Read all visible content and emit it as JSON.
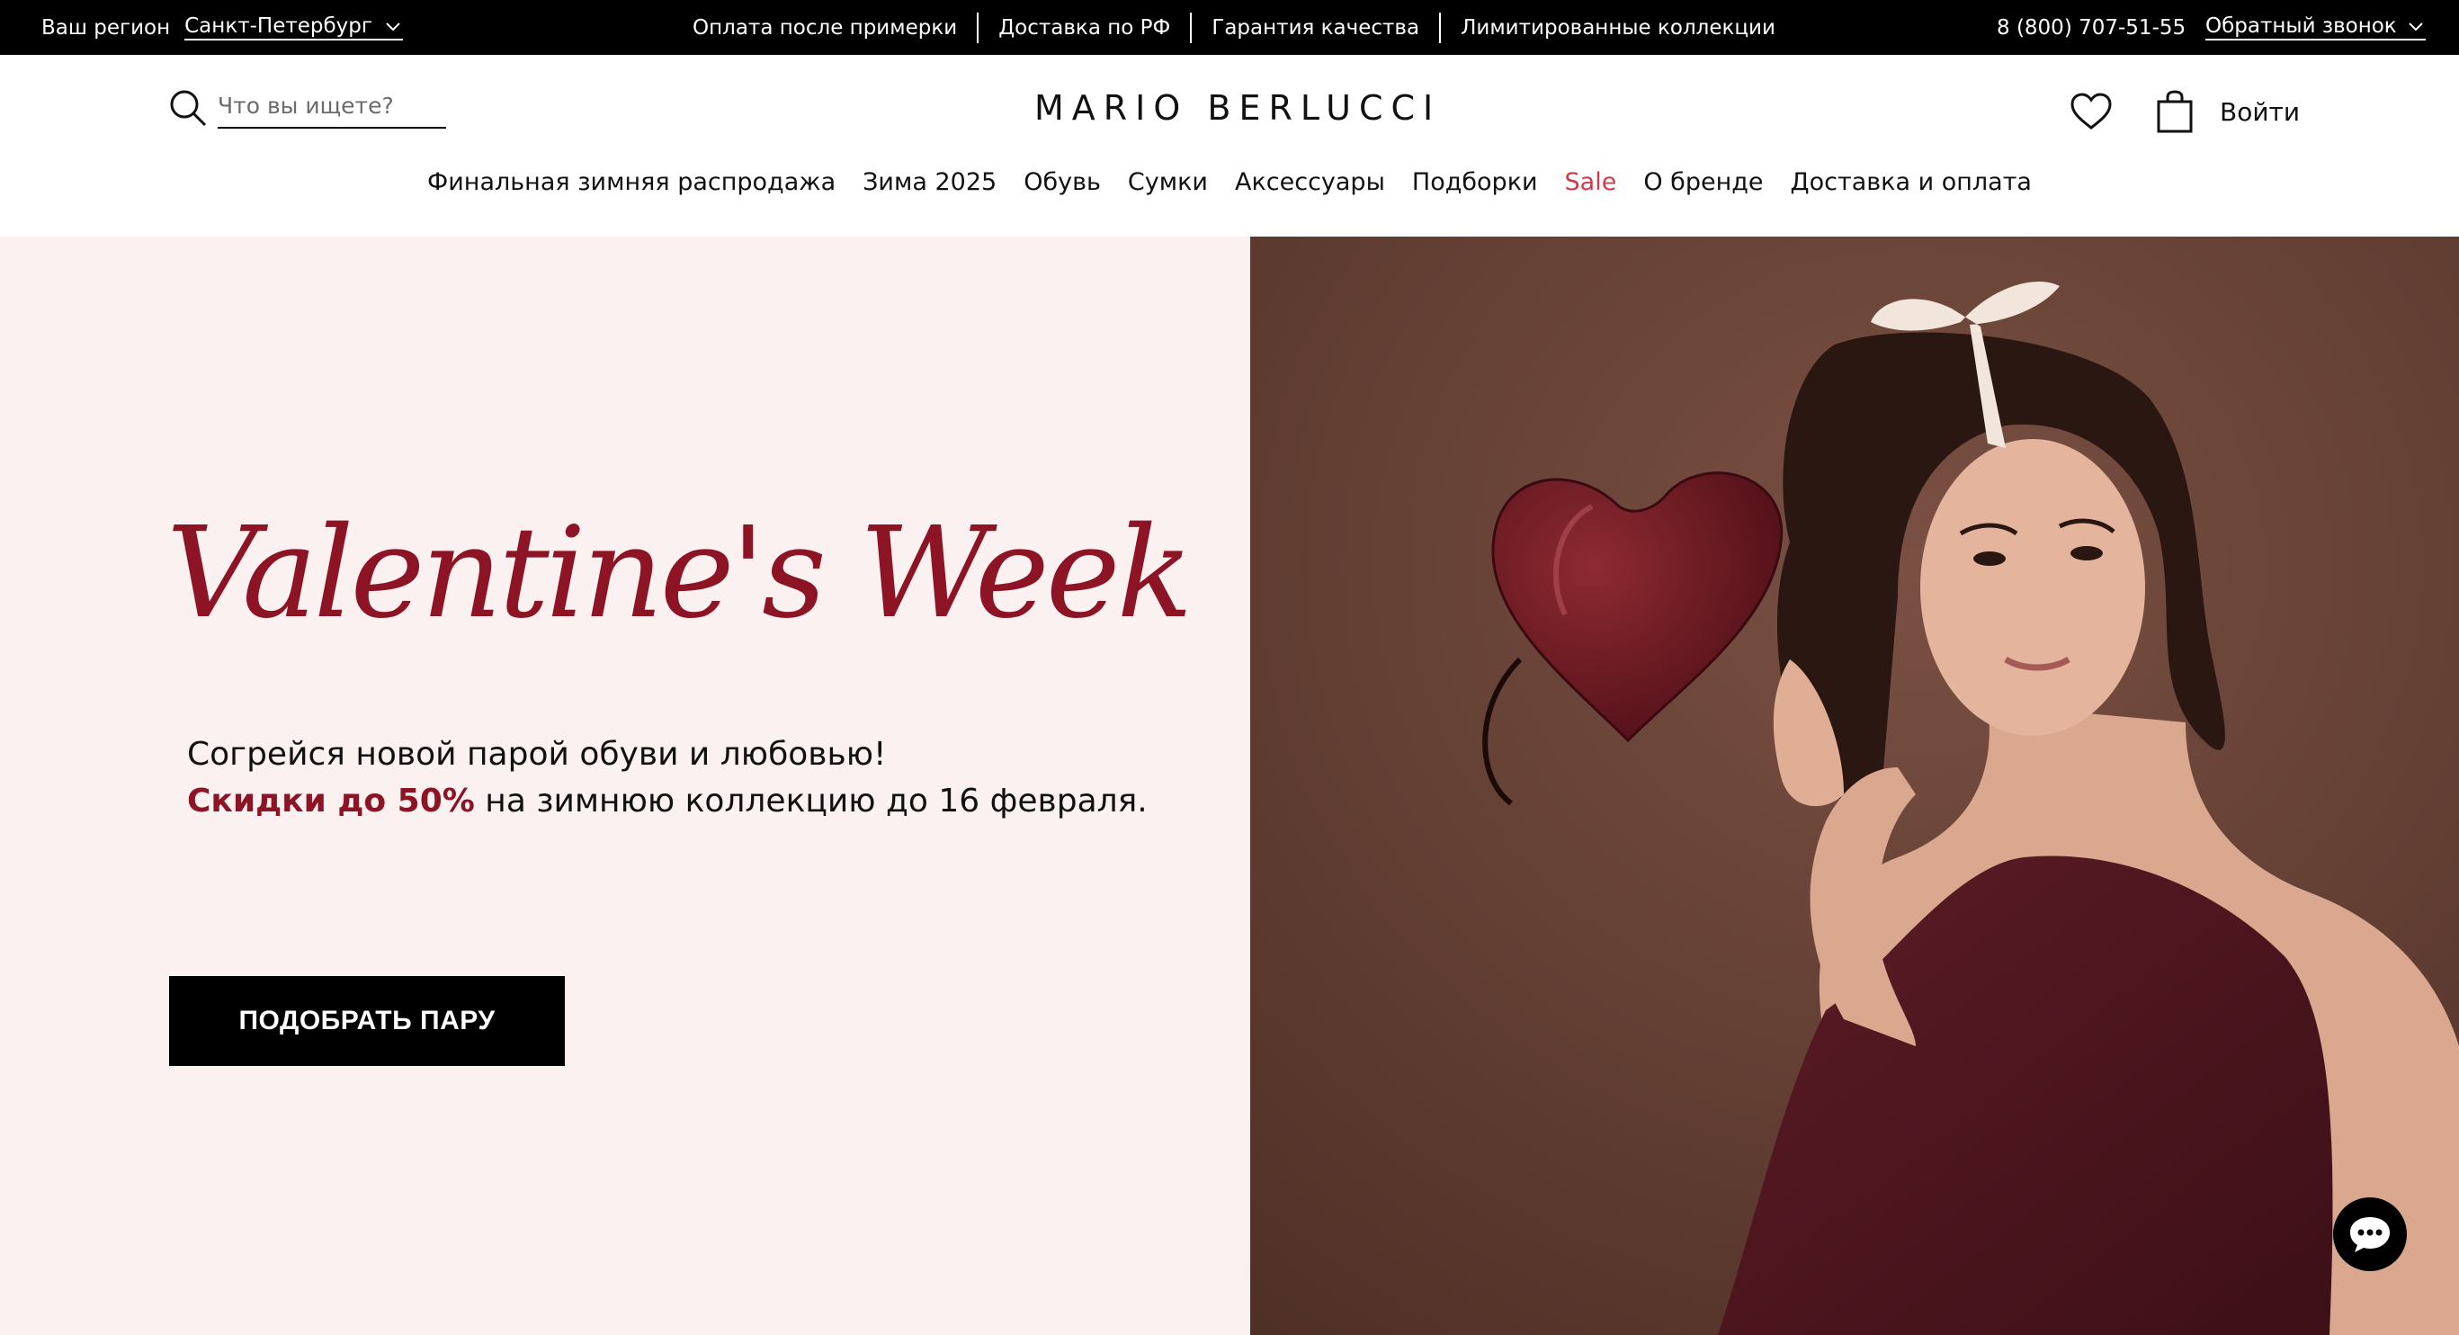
{
  "topbar": {
    "region_label": "Ваш регион",
    "region_value": "Санкт-Петербург",
    "links": [
      "Оплата после примерки",
      "Доставка по РФ",
      "Гарантия качества",
      "Лимитированные коллекции"
    ],
    "phone": "8 (800) 707-51-55",
    "callback": "Обратный звонок"
  },
  "header": {
    "search_placeholder": "Что вы ищете?",
    "logo": "MARIO BERLUCCI",
    "login": "Войти"
  },
  "nav": [
    "Финальная зимняя распродажа",
    "Зима 2025",
    "Обувь",
    "Сумки",
    "Аксессуары",
    "Подборки",
    "Sale",
    "О бренде",
    "Доставка и оплата"
  ],
  "hero": {
    "title": "Valentine's Week",
    "line1": "Согрейся новой парой обуви и любовью!",
    "line2_accent": "Скидки до 50%",
    "line2_rest": " на зимнюю коллекцию до 16 февраля.",
    "cta": "ПОДОБРАТЬ ПАРУ"
  },
  "colors": {
    "accent": "#8c1424",
    "sale": "#d13a4a",
    "hero_bg": "#fcf1f1",
    "photo_bg": "#6a4336"
  },
  "icons": [
    "chevron-down-icon",
    "search-icon",
    "heart-icon",
    "bag-icon",
    "chat-icon"
  ]
}
